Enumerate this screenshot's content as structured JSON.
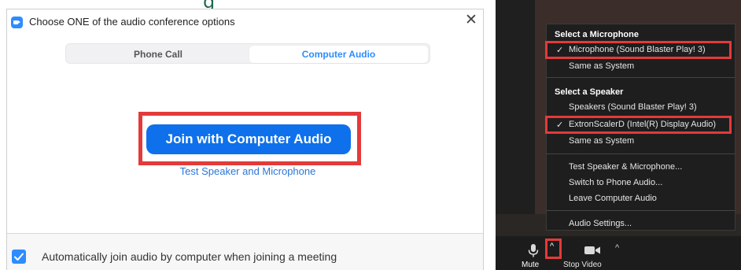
{
  "dialog": {
    "title": "Choose ONE of the audio conference options",
    "close_glyph": "✕",
    "tabs": [
      {
        "label": "Phone Call",
        "active": false
      },
      {
        "label": "Computer Audio",
        "active": true
      }
    ],
    "join_button": "Join with Computer Audio",
    "test_link": "Test Speaker and Microphone",
    "auto_join_checked": true,
    "auto_join_label": "Automatically join audio by computer when joining a meeting"
  },
  "audio_menu": {
    "microphone_header": "Select a Microphone",
    "microphones": [
      {
        "label": "Microphone (Sound Blaster Play! 3)",
        "selected": true
      },
      {
        "label": "Same as System",
        "selected": false
      }
    ],
    "speaker_header": "Select a Speaker",
    "speakers": [
      {
        "label": "Speakers (Sound Blaster Play! 3)",
        "selected": false
      },
      {
        "label": "ExtronScalerD (Intel(R) Display Audio)",
        "selected": true
      },
      {
        "label": "Same as System",
        "selected": false
      }
    ],
    "actions": [
      {
        "label": "Test Speaker & Microphone..."
      },
      {
        "label": "Switch to Phone Audio..."
      },
      {
        "label": "Leave Computer Audio"
      }
    ],
    "settings": "Audio Settings...",
    "check_glyph": "✓"
  },
  "meeting_toolbar": {
    "mute_label": "Mute",
    "caret_glyph": "^",
    "stop_video_label": "Stop Video"
  },
  "colors": {
    "accent_blue": "#0e71eb",
    "link_blue": "#2d75d8",
    "highlight_red": "#e33a3a",
    "menu_bg": "#1e1e1e"
  },
  "icons": [
    "zoom-app-icon",
    "close-icon",
    "checkbox-icon",
    "check-icon",
    "microphone-icon",
    "chevron-up-icon",
    "video-camera-icon"
  ]
}
